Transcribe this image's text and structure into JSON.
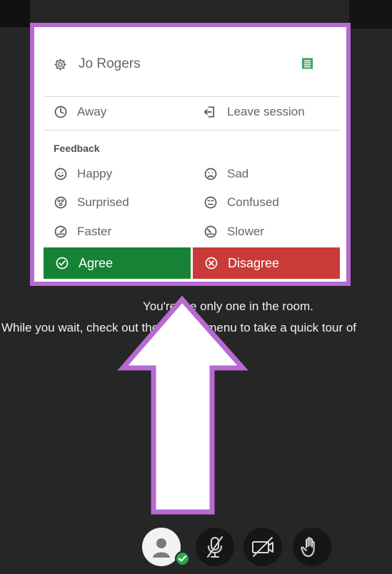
{
  "menu": {
    "user_name": "Jo Rogers",
    "status": {
      "away": "Away",
      "leave": "Leave session"
    },
    "feedback_title": "Feedback",
    "feedback": [
      {
        "label": "Happy",
        "icon": "happy-face-icon"
      },
      {
        "label": "Sad",
        "icon": "sad-face-icon"
      },
      {
        "label": "Surprised",
        "icon": "surprised-face-icon"
      },
      {
        "label": "Confused",
        "icon": "confused-face-icon"
      },
      {
        "label": "Faster",
        "icon": "faster-speed-icon"
      },
      {
        "label": "Slower",
        "icon": "slower-speed-icon"
      }
    ],
    "agree_label": "Agree",
    "disagree_label": "Disagree"
  },
  "notification": {
    "line_1": "You're the only one in the room.",
    "line_2": "While you wait, check out the session menu to take a quick tour of"
  },
  "controls": {
    "avatar_status": "online",
    "mic_state": "muted",
    "camera_state": "off",
    "hand_state": "available"
  },
  "colors": {
    "frame": "#b66ad2",
    "agree": "#168236",
    "disagree": "#c93b38",
    "background": "#262626",
    "online": "#27a74a"
  }
}
